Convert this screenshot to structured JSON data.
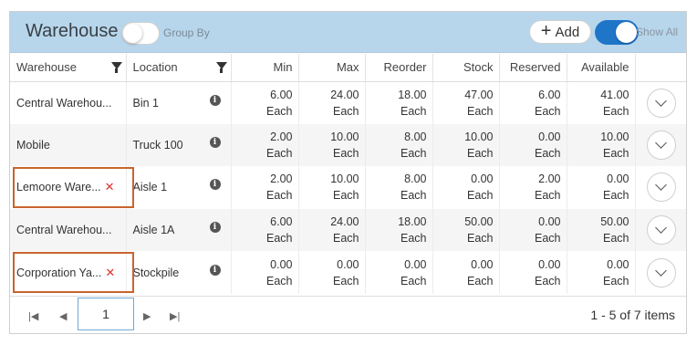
{
  "header": {
    "title": "Warehouse",
    "group_by_label": "Group By",
    "add_label": "Add",
    "show_all_label": "Show All"
  },
  "columns": {
    "warehouse": "Warehouse",
    "location": "Location",
    "min": "Min",
    "max": "Max",
    "reorder": "Reorder",
    "stock": "Stock",
    "reserved": "Reserved",
    "available": "Available"
  },
  "unit": "Each",
  "rows": [
    {
      "warehouse": "Central Warehou...",
      "location": "Bin 1",
      "min": "6.00",
      "max": "24.00",
      "reorder": "18.00",
      "stock": "47.00",
      "reserved": "6.00",
      "available": "41.00"
    },
    {
      "warehouse": "Mobile",
      "location": "Truck 100",
      "min": "2.00",
      "max": "10.00",
      "reorder": "8.00",
      "stock": "10.00",
      "reserved": "0.00",
      "available": "10.00"
    },
    {
      "warehouse": "Lemoore Ware...",
      "location": "Aisle 1",
      "min": "2.00",
      "max": "10.00",
      "reorder": "8.00",
      "stock": "0.00",
      "reserved": "2.00",
      "available": "0.00"
    },
    {
      "warehouse": "Central Warehou...",
      "location": "Aisle 1A",
      "min": "6.00",
      "max": "24.00",
      "reorder": "18.00",
      "stock": "50.00",
      "reserved": "0.00",
      "available": "50.00"
    },
    {
      "warehouse": "Corporation Ya...",
      "location": "Stockpile",
      "min": "0.00",
      "max": "0.00",
      "reorder": "0.00",
      "stock": "0.00",
      "reserved": "0.00",
      "available": "0.00"
    }
  ],
  "pager": {
    "current_page": "1",
    "info": "1 - 5 of 7 items"
  },
  "colors": {
    "header_bg": "#b7d6ec",
    "toggle_on": "#1f75c8",
    "error_x": "#e0322f",
    "highlight_border": "#c8642d"
  }
}
